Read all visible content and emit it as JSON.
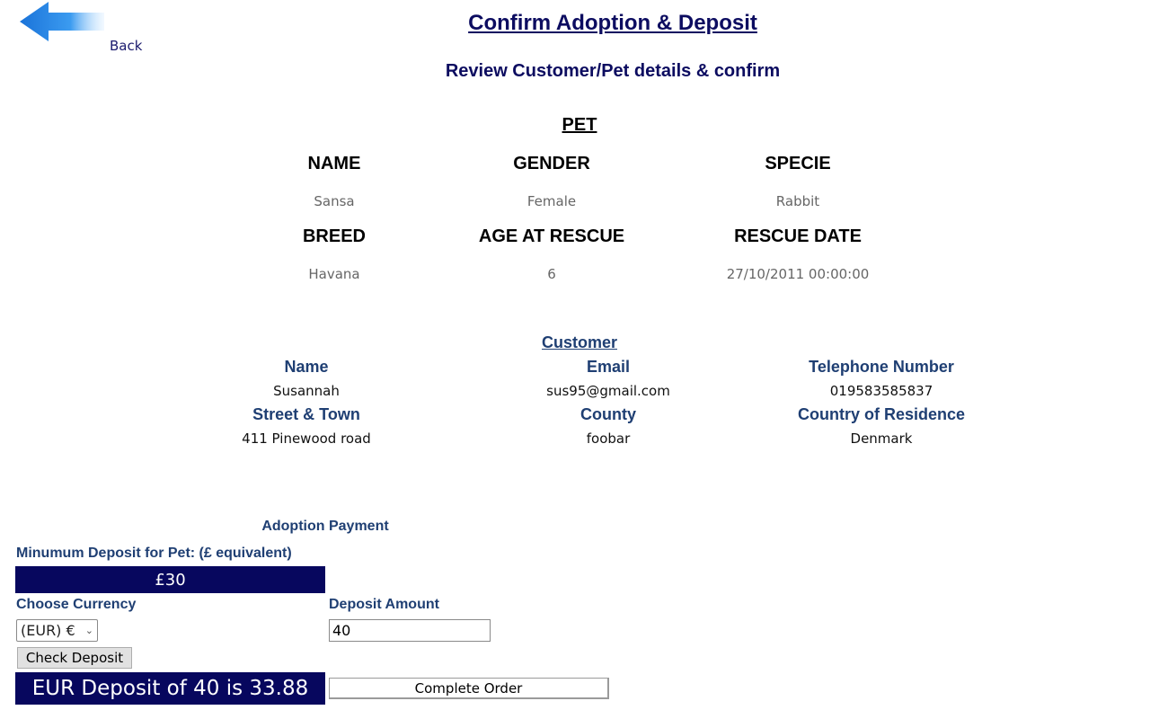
{
  "nav": {
    "back_label": "Back"
  },
  "header": {
    "title": "Confirm Adoption & Deposit",
    "subtitle": "Review Customer/Pet details & confirm"
  },
  "pet": {
    "title": "PET",
    "fields": [
      {
        "label": "NAME",
        "value": "Sansa"
      },
      {
        "label": "GENDER",
        "value": "Female"
      },
      {
        "label": "SPECIE",
        "value": "Rabbit"
      },
      {
        "label": "BREED",
        "value": "Havana"
      },
      {
        "label": "AGE AT RESCUE",
        "value": "6"
      },
      {
        "label": "RESCUE DATE",
        "value": "27/10/2011 00:00:00"
      }
    ]
  },
  "customer": {
    "title": "Customer",
    "fields": [
      {
        "label": "Name",
        "value": "Susannah"
      },
      {
        "label": "Email",
        "value": "sus95@gmail.com"
      },
      {
        "label": "Telephone Number",
        "value": "019583585837"
      },
      {
        "label": "Street & Town",
        "value": "411 Pinewood road"
      },
      {
        "label": "County",
        "value": "foobar"
      },
      {
        "label": "Country of Residence",
        "value": "Denmark"
      }
    ]
  },
  "payment": {
    "title": "Adoption Payment",
    "min_deposit_label": "Minumum Deposit for Pet:  (£ equivalent)",
    "min_deposit_value": "£30",
    "currency_label": "Choose Currency",
    "currency_selected": "(EUR) €",
    "deposit_label": "Deposit Amount",
    "deposit_value": "40",
    "check_button": "Check Deposit",
    "result_text": "EUR Deposit of 40 is 33.88",
    "complete_button": "Complete Order"
  },
  "colors": {
    "navy_box": "#07075e",
    "title_text": "#0c0c60",
    "section_blue": "#1f3f73",
    "back_arrow": "#2b7de0"
  },
  "icons": {
    "back": "left-arrow-icon",
    "select_chevron": "chevron-down-icon"
  }
}
